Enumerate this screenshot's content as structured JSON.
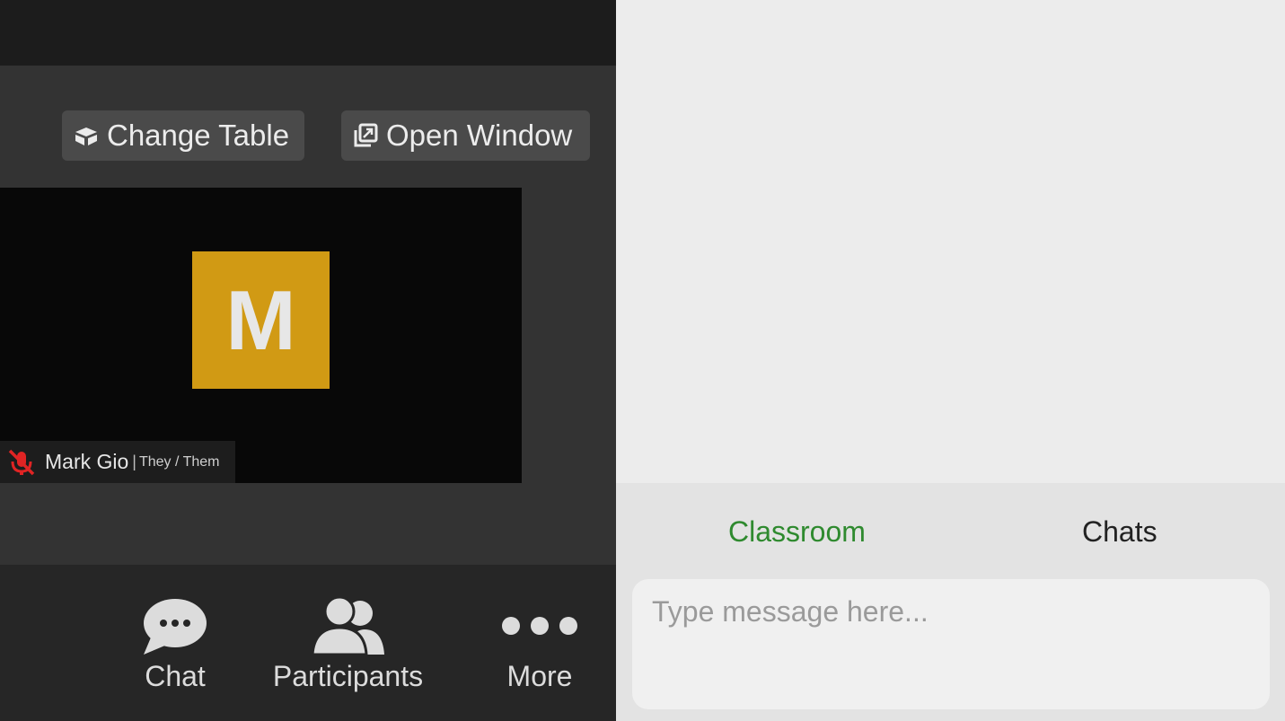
{
  "meeting": {
    "buttons": {
      "change_table": "Change Table",
      "open_window": "Open Window"
    },
    "participant": {
      "initial": "M",
      "name": "Mark Gio",
      "separator": "|",
      "pronouns": "They / Them",
      "mic_status": "muted",
      "avatar_color": "#d19a14"
    },
    "toolbar": {
      "chat": "Chat",
      "participants": "Participants",
      "more": "More"
    }
  },
  "chat_panel": {
    "tabs": [
      {
        "label": "Classroom",
        "active": true,
        "color": "#2f8a2f"
      },
      {
        "label": "Chats",
        "active": false
      }
    ],
    "message_input": {
      "placeholder": "Type message here...",
      "value": ""
    }
  },
  "icons": {
    "change_table": "table-swap-icon",
    "open_window": "popout-window-icon",
    "mic": "mic-muted-icon",
    "chat": "chat-bubble-icon",
    "participants": "participants-icon",
    "more": "more-dots-icon"
  },
  "colors": {
    "muted_red": "#e02424",
    "accent_green": "#2f8a2f"
  }
}
